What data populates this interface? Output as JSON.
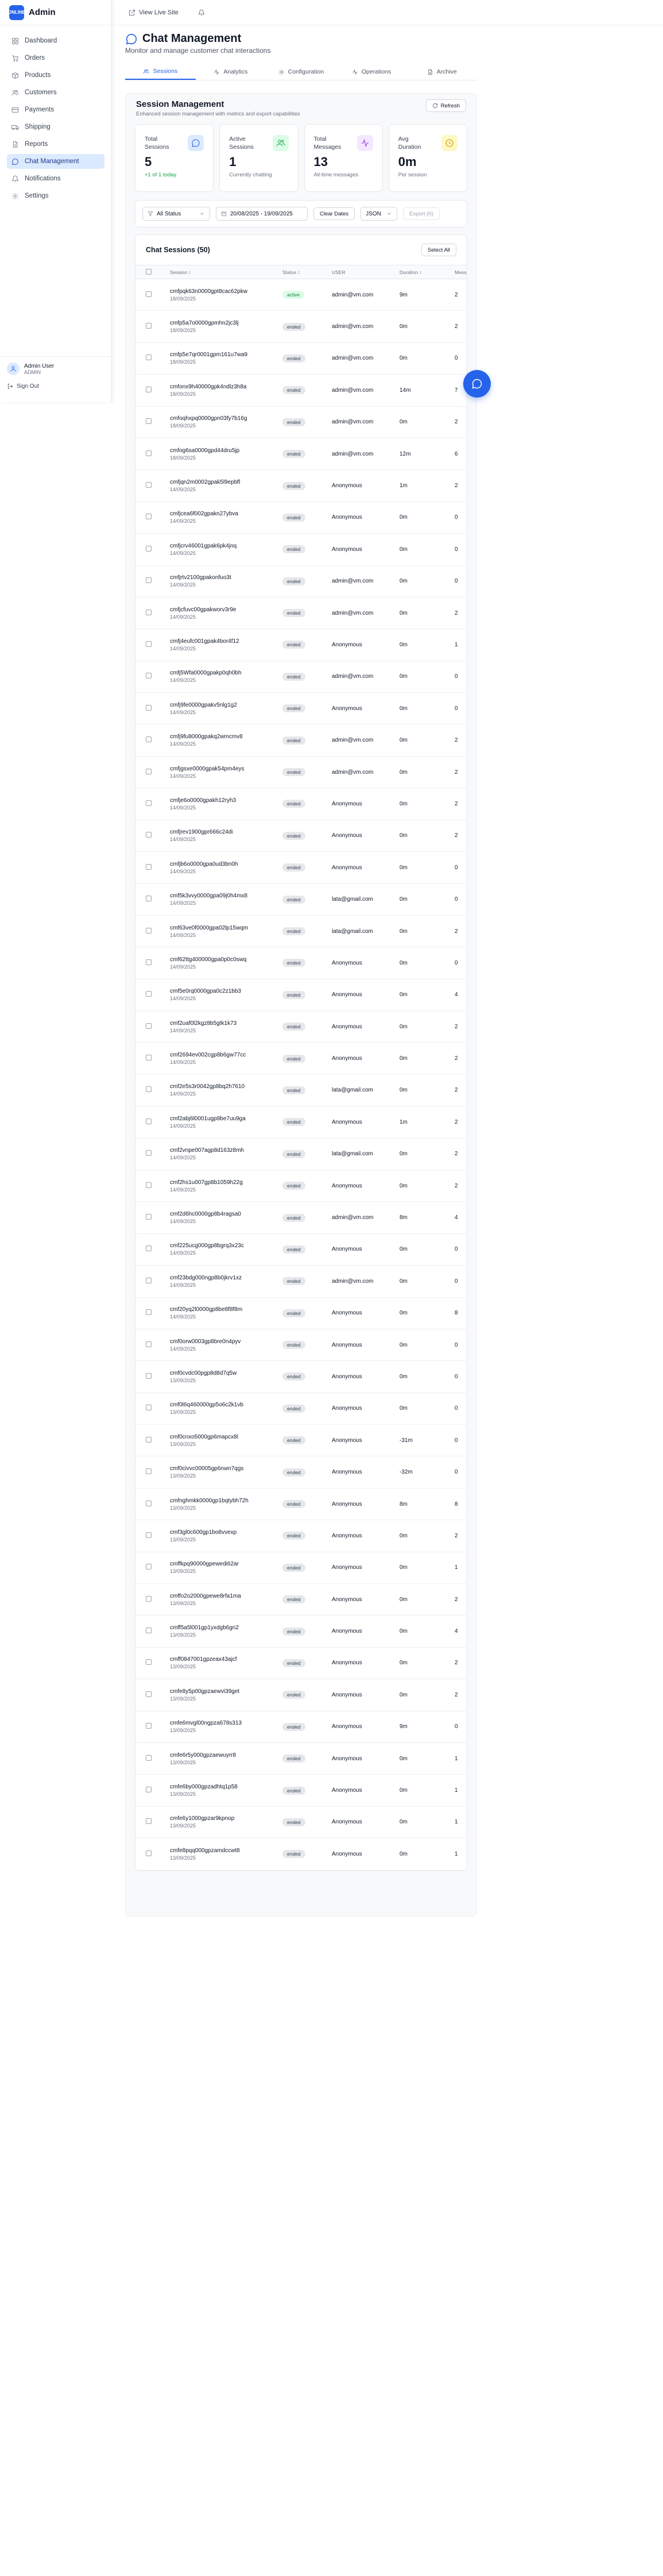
{
  "sidebar": {
    "brand_logo": "ONLINE",
    "brand_name": "Admin",
    "items": [
      {
        "label": "Dashboard",
        "icon": "dashboard-icon"
      },
      {
        "label": "Orders",
        "icon": "cart-icon"
      },
      {
        "label": "Products",
        "icon": "box-icon"
      },
      {
        "label": "Customers",
        "icon": "users-icon"
      },
      {
        "label": "Payments",
        "icon": "credit-card-icon"
      },
      {
        "label": "Shipping",
        "icon": "truck-icon"
      },
      {
        "label": "Reports",
        "icon": "file-icon"
      },
      {
        "label": "Chat Management",
        "icon": "chat-icon",
        "active": true
      },
      {
        "label": "Notifications",
        "icon": "bell-icon"
      },
      {
        "label": "Settings",
        "icon": "gear-icon"
      }
    ],
    "user_name": "Admin User",
    "user_role": "ADMIN",
    "sign_out": "Sign Out"
  },
  "topbar": {
    "visit_label": "View Live Site"
  },
  "page": {
    "title": "Chat Management",
    "subtitle": "Monitor and manage customer chat interactions"
  },
  "tabs": [
    {
      "label": "Sessions",
      "active": true
    },
    {
      "label": "Analytics"
    },
    {
      "label": "Configuration"
    },
    {
      "label": "Operations"
    },
    {
      "label": "Archive"
    }
  ],
  "panel": {
    "title": "Session Management",
    "subtitle": "Enhanced session management with metrics and export capabilities",
    "refresh_label": "Refresh"
  },
  "stats": [
    {
      "label": "Total Sessions",
      "value": "5",
      "note": "+1 of 1 today",
      "note_color": "#16a34a",
      "icon": "chat-icon",
      "bg": "#dbeafe",
      "color": "#2563eb"
    },
    {
      "label": "Active Sessions",
      "value": "1",
      "note": "Currently chatting",
      "icon": "users-icon",
      "bg": "#dcfce7",
      "color": "#16a34a"
    },
    {
      "label": "Total Messages",
      "value": "13",
      "note": "All-time messages",
      "icon": "activity-icon",
      "bg": "#f3e8ff",
      "color": "#9333ea"
    },
    {
      "label": "Avg Duration",
      "value": "0m",
      "note": "Per session",
      "icon": "clock-icon",
      "bg": "#fef9c3",
      "color": "#ca8a04"
    }
  ],
  "filters": {
    "status_value": "All Status",
    "date_range": "20/08/2025 - 19/09/2025",
    "clear_dates": "Clear Dates",
    "format_value": "JSON",
    "export_label": "Export (0)"
  },
  "table": {
    "title": "Chat Sessions (50)",
    "select_all": "Select All",
    "headers": [
      "Session",
      "Status",
      "USER",
      "Duration",
      "Messages"
    ],
    "rows": [
      {
        "id": "cmfpqk63n0000gpt8cac62pkw",
        "date": "18/09/2025",
        "status": "active",
        "user": "admin@vm.com",
        "duration": "9m",
        "messages": "2"
      },
      {
        "id": "cmfp5a7o0000gpmhn2jc3lj",
        "date": "18/09/2025",
        "status": "ended",
        "user": "admin@vm.com",
        "duration": "0m",
        "messages": "2"
      },
      {
        "id": "cmfp5e7qr0001gpm161u7wa9",
        "date": "18/09/2025",
        "status": "ended",
        "user": "admin@vm.com",
        "duration": "0m",
        "messages": "0"
      },
      {
        "id": "cmfonx9h40000gpk4ndlz3h8a",
        "date": "18/09/2025",
        "status": "ended",
        "user": "admin@vm.com",
        "duration": "14m",
        "messages": "7"
      },
      {
        "id": "cmfoqhxpq0000gpn03fy7b16g",
        "date": "18/09/2025",
        "status": "ended",
        "user": "admin@vm.com",
        "duration": "0m",
        "messages": "2"
      },
      {
        "id": "cmfog6sa0000gpd44dru5jp",
        "date": "18/09/2025",
        "status": "ended",
        "user": "admin@vm.com",
        "duration": "12m",
        "messages": "6"
      },
      {
        "id": "cmfjqn2m0002gpak5l9epbfl",
        "date": "14/09/2025",
        "status": "ended",
        "user": "Anonymous",
        "duration": "1m",
        "messages": "2"
      },
      {
        "id": "cmfjcea6f002gpakn27ybva",
        "date": "14/09/2025",
        "status": "ended",
        "user": "Anonymous",
        "duration": "0m",
        "messages": "0"
      },
      {
        "id": "cmfjcrv46001gpak6pk4jnq",
        "date": "14/09/2025",
        "status": "ended",
        "user": "Anonymous",
        "duration": "0m",
        "messages": "0"
      },
      {
        "id": "cmfjrtv2100gpakonfuo3t",
        "date": "14/09/2025",
        "status": "ended",
        "user": "admin@vm.com",
        "duration": "0m",
        "messages": "0"
      },
      {
        "id": "cmfjcfuvc00gpakworv3r9e",
        "date": "14/09/2025",
        "status": "ended",
        "user": "admin@vm.com",
        "duration": "0m",
        "messages": "2"
      },
      {
        "id": "cmfj4eufc001gpak4bor4f12",
        "date": "14/09/2025",
        "status": "ended",
        "user": "Anonymous",
        "duration": "0m",
        "messages": "1"
      },
      {
        "id": "cmfj5Wfa0000gpakp0qh0bh",
        "date": "14/09/2025",
        "status": "ended",
        "user": "admin@vm.com",
        "duration": "0m",
        "messages": "0"
      },
      {
        "id": "cmfj9fe0000gpakv5nlg1g2",
        "date": "14/09/2025",
        "status": "ended",
        "user": "Anonymous",
        "duration": "0m",
        "messages": "0"
      },
      {
        "id": "cmfj9fu8000gpakq2wmcmv8",
        "date": "14/09/2025",
        "status": "ended",
        "user": "admin@vm.com",
        "duration": "0m",
        "messages": "2"
      },
      {
        "id": "cmfjgsxe0000gpak54pm4eys",
        "date": "14/09/2025",
        "status": "ended",
        "user": "admin@vm.com",
        "duration": "0m",
        "messages": "2"
      },
      {
        "id": "cmfje6o0000gpakh12ryh3",
        "date": "14/09/2025",
        "status": "ended",
        "user": "Anonymous",
        "duration": "0m",
        "messages": "2"
      },
      {
        "id": "cmfjrev1900gpr666c24di",
        "date": "14/09/2025",
        "status": "ended",
        "user": "Anonymous",
        "duration": "0m",
        "messages": "2"
      },
      {
        "id": "cmfjb6o0000gpa0ud3bn0h",
        "date": "14/09/2025",
        "status": "ended",
        "user": "Anonymous",
        "duration": "0m",
        "messages": "0"
      },
      {
        "id": "cmf5k3vvy0000gpa09j0h4mx8",
        "date": "14/09/2025",
        "status": "ended",
        "user": "lata@gmail.com",
        "duration": "0m",
        "messages": "0"
      },
      {
        "id": "cmf63ve0f0000gpa02lp15wqm",
        "date": "14/09/2025",
        "status": "ended",
        "user": "lata@gmail.com",
        "duration": "0m",
        "messages": "2"
      },
      {
        "id": "cmf62ttg400000gpa0p0c0swq",
        "date": "14/09/2025",
        "status": "ended",
        "user": "Anonymous",
        "duration": "0m",
        "messages": "0"
      },
      {
        "id": "cmf5e0rq0000gpa0c2z1bb3",
        "date": "14/09/2025",
        "status": "ended",
        "user": "Anonymous",
        "duration": "0m",
        "messages": "4"
      },
      {
        "id": "cmf2uaf0l2kgz8b5gtk1k73",
        "date": "14/09/2025",
        "status": "ended",
        "user": "Anonymous",
        "duration": "0m",
        "messages": "2"
      },
      {
        "id": "cmf2694ev002cgp8b6gw77cc",
        "date": "14/09/2025",
        "status": "ended",
        "user": "Anonymous",
        "duration": "0m",
        "messages": "2"
      },
      {
        "id": "cmf2e5s3r0042gp8bq2h7610",
        "date": "14/09/2025",
        "status": "ended",
        "user": "lata@gmail.com",
        "duration": "0m",
        "messages": "2"
      },
      {
        "id": "cmf2abj6l0001ugp8be7uu9ga",
        "date": "14/09/2025",
        "status": "ended",
        "user": "Anonymous",
        "duration": "1m",
        "messages": "2"
      },
      {
        "id": "cmf2vnpe007agp8d163z8mh",
        "date": "14/09/2025",
        "status": "ended",
        "user": "lata@gmail.com",
        "duration": "0m",
        "messages": "2"
      },
      {
        "id": "cmf2hs1u007gp8b1059h22g",
        "date": "14/09/2025",
        "status": "ended",
        "user": "Anonymous",
        "duration": "0m",
        "messages": "2"
      },
      {
        "id": "cmf2d6hc0000gp8b4ragsa0",
        "date": "14/09/2025",
        "status": "ended",
        "user": "admin@vm.com",
        "duration": "8m",
        "messages": "4"
      },
      {
        "id": "cmf225ucg000gp8bgrq3x23c",
        "date": "14/09/2025",
        "status": "ended",
        "user": "Anonymous",
        "duration": "0m",
        "messages": "0"
      },
      {
        "id": "cmf23bdg000ngp8b0jkrv1xz",
        "date": "14/09/2025",
        "status": "ended",
        "user": "admin@vm.com",
        "duration": "0m",
        "messages": "0"
      },
      {
        "id": "cmf20yq2l0000gp8be8f8f8m",
        "date": "14/09/2025",
        "status": "ended",
        "user": "Anonymous",
        "duration": "0m",
        "messages": "8"
      },
      {
        "id": "cmf0orw0003gp8bre0n4pyv",
        "date": "14/09/2025",
        "status": "ended",
        "user": "Anonymous",
        "duration": "0m",
        "messages": "0"
      },
      {
        "id": "cmf0cvdc00pgp8d8d7q5w",
        "date": "13/09/2025",
        "status": "ended",
        "user": "Anonymous",
        "duration": "0m",
        "messages": "0"
      },
      {
        "id": "cmf0l6q460000gp5o6c2k1vb",
        "date": "13/09/2025",
        "status": "ended",
        "user": "Anonymous",
        "duration": "0m",
        "messages": "0"
      },
      {
        "id": "cmf0cnxo5000gp6mapcx8l",
        "date": "13/09/2025",
        "status": "ended",
        "user": "Anonymous",
        "duration": "-31m",
        "messages": "0"
      },
      {
        "id": "cmf0civvc00005gp6nwn7qgs",
        "date": "13/09/2025",
        "status": "ended",
        "user": "Anonymous",
        "duration": "-32m",
        "messages": "0"
      },
      {
        "id": "cmfnghmkk0000gp1bqtybh72h",
        "date": "13/09/2025",
        "status": "ended",
        "user": "Anonymous",
        "duration": "8m",
        "messages": "8"
      },
      {
        "id": "cmf3gl0c600gp1bo8vvexp",
        "date": "13/09/2025",
        "status": "ended",
        "user": "Anonymous",
        "duration": "0m",
        "messages": "2"
      },
      {
        "id": "cmffkpq90000gpewedi62ar",
        "date": "13/09/2025",
        "status": "ended",
        "user": "Anonymous",
        "duration": "0m",
        "messages": "1"
      },
      {
        "id": "cmffo2o2000gpewe8rfa1ma",
        "date": "13/09/2025",
        "status": "ended",
        "user": "Anonymous",
        "duration": "0m",
        "messages": "2"
      },
      {
        "id": "cmff5a5l001gp1yxdgb6gn2",
        "date": "13/09/2025",
        "status": "ended",
        "user": "Anonymous",
        "duration": "0m",
        "messages": "4"
      },
      {
        "id": "cmff0847001gpzeax43ajcf",
        "date": "13/09/2025",
        "status": "ended",
        "user": "Anonymous",
        "duration": "0m",
        "messages": "2"
      },
      {
        "id": "cmfe8y5p00gpzaewvi39get",
        "date": "13/09/2025",
        "status": "ended",
        "user": "Anonymous",
        "duration": "0m",
        "messages": "2"
      },
      {
        "id": "cmfe6mvgl00ngpza678s313",
        "date": "13/09/2025",
        "status": "ended",
        "user": "Anonymous",
        "duration": "9m",
        "messages": "0"
      },
      {
        "id": "cmfe6r5y000gpzaewuyrr8",
        "date": "13/09/2025",
        "status": "ended",
        "user": "Anonymous",
        "duration": "0m",
        "messages": "1"
      },
      {
        "id": "cmfe6by000gpzadhtq1p58",
        "date": "13/09/2025",
        "status": "ended",
        "user": "Anonymous",
        "duration": "0m",
        "messages": "1"
      },
      {
        "id": "cmfe6y1000gpzar9kpnop",
        "date": "13/09/2025",
        "status": "ended",
        "user": "Anonymous",
        "duration": "0m",
        "messages": "1"
      },
      {
        "id": "cmfe8pqq000gpzamdccwt8",
        "date": "13/09/2025",
        "status": "ended",
        "user": "Anonymous",
        "duration": "0m",
        "messages": "1"
      }
    ]
  }
}
